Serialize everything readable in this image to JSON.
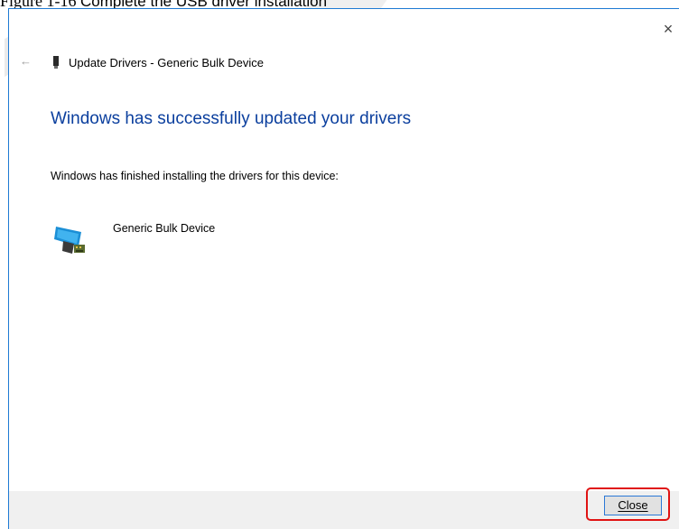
{
  "caption": {
    "prefix": "Figure 1-16",
    "text": "Complete the USB driver installation"
  },
  "window": {
    "close_glyph": "×",
    "back_glyph": "←",
    "title": "Update Drivers - Generic Bulk Device"
  },
  "content": {
    "heading": "Windows has successfully updated your drivers",
    "description": "Windows has finished installing the drivers for this device:",
    "device_name": "Generic Bulk Device",
    "device_icon": "usb-device-icon"
  },
  "footer": {
    "close_label": "Close"
  },
  "colors": {
    "heading": "#0b3f9e",
    "highlight": "#e01313",
    "button_border": "#2b78d6",
    "footer_bg": "#f0f0f0"
  }
}
